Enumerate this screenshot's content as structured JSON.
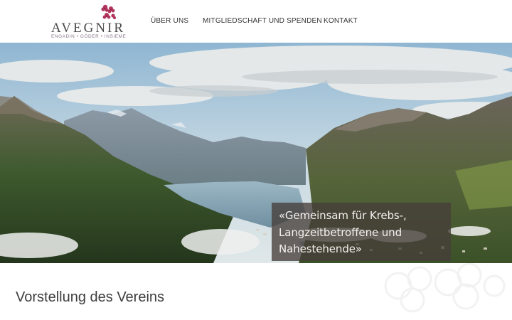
{
  "brand": {
    "name": "AVEGNIR",
    "tagline": "ENGADIN • GÖDER • INSIEME",
    "accent_color": "#b0345c"
  },
  "nav": {
    "items": [
      {
        "label": "ÜBER UNS"
      },
      {
        "label": "MITGLIEDSCHAFT UND SPENDEN"
      },
      {
        "label": "KONTAKT"
      }
    ]
  },
  "hero": {
    "quote_line1": "«Gemeinsam für Krebs-,",
    "quote_line2": "Langzeitbetroffene und",
    "quote_line3": "Nahestehende»"
  },
  "content": {
    "section_title": "Vorstellung des Vereins"
  }
}
